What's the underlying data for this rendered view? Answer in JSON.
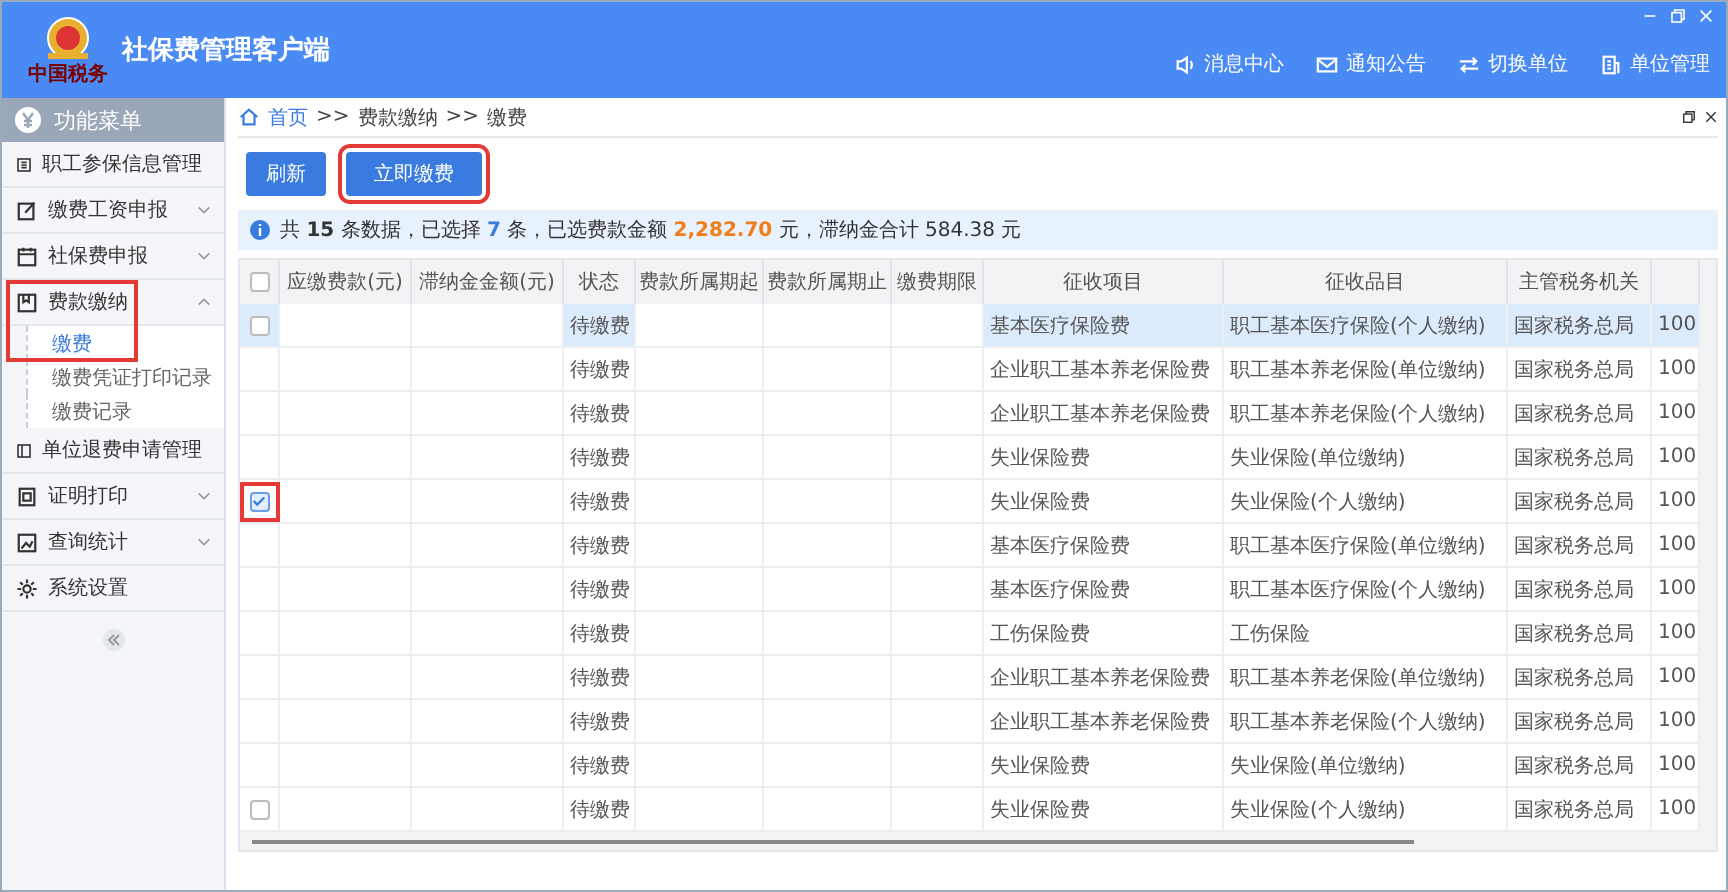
{
  "window": {
    "title": "社保费管理客户端",
    "logo_caption": "中国税务"
  },
  "header_nav": [
    {
      "label": "消息中心",
      "kind": "message"
    },
    {
      "label": "通知公告",
      "kind": "notice"
    },
    {
      "label": "切换单位",
      "kind": "switch"
    },
    {
      "label": "单位管理",
      "kind": "unit"
    }
  ],
  "sidebar": {
    "title": "功能菜单",
    "items": [
      {
        "label": "职工参保信息管理"
      },
      {
        "label": "缴费工资申报",
        "expanded": false
      },
      {
        "label": "社保费申报",
        "expanded": false
      },
      {
        "label": "费款缴纳",
        "expanded": true,
        "annotated": true,
        "children": [
          {
            "label": "缴费",
            "selected": true
          },
          {
            "label": "缴费凭证打印记录",
            "selected": false
          },
          {
            "label": "缴费记录",
            "selected": false
          }
        ]
      },
      {
        "label": "单位退费申请管理"
      },
      {
        "label": "证明打印",
        "expanded": false
      },
      {
        "label": "查询统计",
        "expanded": false
      },
      {
        "label": "系统设置"
      }
    ]
  },
  "breadcrumb": [
    {
      "label": "首页",
      "link": true
    },
    {
      "label": ">>",
      "link": false
    },
    {
      "label": "费款缴纳",
      "link": false
    },
    {
      "label": ">>",
      "link": false
    },
    {
      "label": "缴费",
      "link": false
    }
  ],
  "buttons": [
    {
      "label": "刷新"
    },
    {
      "label": "立即缴费",
      "annotated": true
    }
  ],
  "summary": [
    {
      "text": "共 ",
      "kind": "plain"
    },
    {
      "text": "15",
      "kind": "bold"
    },
    {
      "text": " 条数据，已选择 ",
      "kind": "plain"
    },
    {
      "text": "7",
      "kind": "blue"
    },
    {
      "text": " 条，已选费款金额 ",
      "kind": "plain"
    },
    {
      "text": "2,282.70",
      "kind": "amount"
    },
    {
      "text": " 元，滞纳金合计 584.38 元",
      "kind": "plain"
    }
  ],
  "table": {
    "header_checked": false,
    "columns": [
      "应缴费款(元)",
      "滞纳金金额(元)",
      "状态",
      "费款所属期起",
      "费款所属期止",
      "缴费期限",
      "征收项目",
      "征收品目",
      "主管税务机关"
    ],
    "rows": [
      {
        "selected": true,
        "checked": false,
        "status": "待缴费",
        "item": "基本医疗保险费",
        "category": "职工基本医疗保险(个人缴纳)",
        "authority": "国家税务总局",
        "column_10": "100"
      },
      {
        "selected": false,
        "status": "待缴费",
        "item": "企业职工基本养老保险费",
        "category": "职工基本养老保险(单位缴纳)",
        "authority": "国家税务总局",
        "column_10": "100"
      },
      {
        "selected": false,
        "status": "待缴费",
        "item": "企业职工基本养老保险费",
        "category": "职工基本养老保险(个人缴纳)",
        "authority": "国家税务总局",
        "column_10": "100"
      },
      {
        "selected": false,
        "status": "待缴费",
        "item": "失业保险费",
        "category": "失业保险(单位缴纳)",
        "authority": "国家税务总局",
        "column_10": "100"
      },
      {
        "selected": false,
        "checked": true,
        "annotated": true,
        "status": "待缴费",
        "item": "失业保险费",
        "category": "失业保险(个人缴纳)",
        "authority": "国家税务总局",
        "column_10": "100"
      },
      {
        "selected": false,
        "status": "待缴费",
        "item": "基本医疗保险费",
        "category": "职工基本医疗保险(单位缴纳)",
        "authority": "国家税务总局",
        "column_10": "100"
      },
      {
        "selected": false,
        "status": "待缴费",
        "item": "基本医疗保险费",
        "category": "职工基本医疗保险(个人缴纳)",
        "authority": "国家税务总局",
        "column_10": "100"
      },
      {
        "selected": false,
        "status": "待缴费",
        "item": "工伤保险费",
        "category": "工伤保险",
        "authority": "国家税务总局",
        "column_10": "100"
      },
      {
        "selected": false,
        "status": "待缴费",
        "item": "企业职工基本养老保险费",
        "category": "职工基本养老保险(单位缴纳)",
        "authority": "国家税务总局",
        "column_10": "100"
      },
      {
        "selected": false,
        "status": "待缴费",
        "item": "企业职工基本养老保险费",
        "category": "职工基本养老保险(个人缴纳)",
        "authority": "国家税务总局",
        "column_10": "100"
      },
      {
        "selected": false,
        "status": "待缴费",
        "item": "失业保险费",
        "category": "失业保险(单位缴纳)",
        "authority": "国家税务总局",
        "column_10": "100"
      },
      {
        "selected": false,
        "checked": false,
        "status": "待缴费",
        "item": "失业保险费",
        "category": "失业保险(个人缴纳)",
        "authority": "国家税务总局",
        "column_10": "100"
      }
    ]
  }
}
